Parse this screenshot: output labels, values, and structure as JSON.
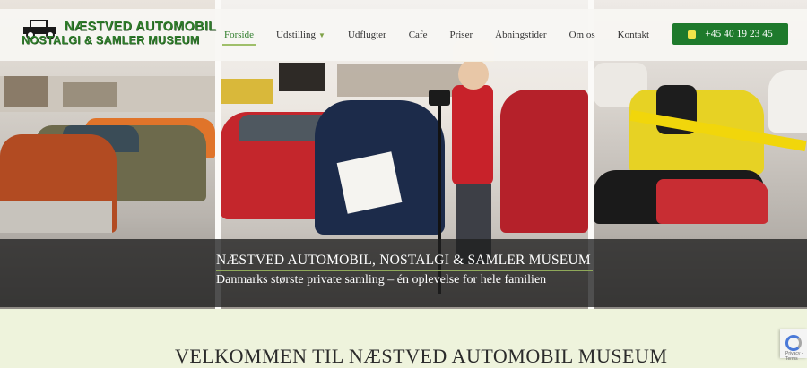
{
  "header": {
    "logo": {
      "line1": "NÆSTVED  AUTOMOBIL",
      "line2": "NOSTALGI & SAMLER MUSEUM",
      "icon": "vintage-car-icon"
    },
    "nav": [
      {
        "label": "Forside",
        "active": true
      },
      {
        "label": "Udstilling",
        "has_dropdown": true
      },
      {
        "label": "Udflugter"
      },
      {
        "label": "Cafe"
      },
      {
        "label": "Priser"
      },
      {
        "label": "Åbningstider"
      },
      {
        "label": "Om os"
      },
      {
        "label": "Kontakt"
      }
    ],
    "phone": {
      "label": "+45 40 19 23 45",
      "icon": "phone-icon"
    }
  },
  "hero": {
    "title": "NÆSTVED AUTOMOBIL, NOSTALGI & SAMLER MUSEUM",
    "subtitle": "Danmarks største private samling – én oplevelse for hele familien"
  },
  "welcome": {
    "title": "VELKOMMEN TIL NÆSTVED AUTOMOBIL MUSEUM"
  },
  "recaptcha": {
    "text": "Privacy - Terms"
  },
  "colors": {
    "brand_green": "#2f7d2b",
    "button_green": "#1e7a2c",
    "page_bg": "#eef3dc",
    "banner_bg": "#1f1f1f"
  }
}
